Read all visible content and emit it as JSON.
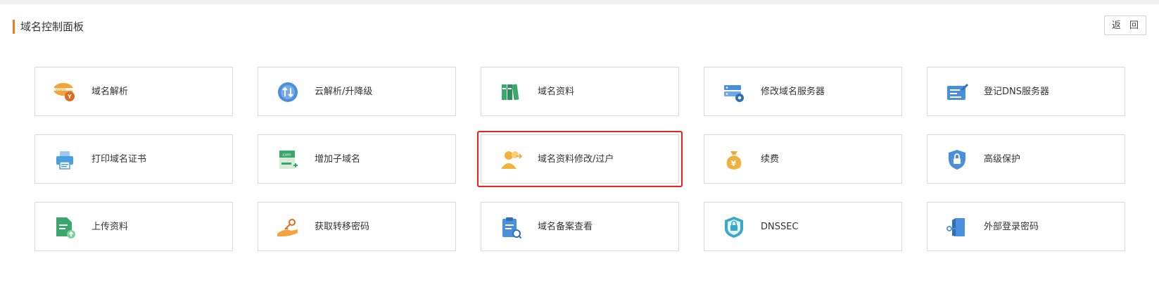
{
  "header": {
    "title": "域名控制面板",
    "back_label": "返 回"
  },
  "colors": {
    "accent": "#f07c22",
    "highlight": "#e8221c"
  },
  "cards": [
    {
      "label": "域名解析",
      "icon": "www-dns-icon"
    },
    {
      "label": "云解析/升降级",
      "icon": "cloud-upgrade-icon"
    },
    {
      "label": "域名资料",
      "icon": "books-icon"
    },
    {
      "label": "修改域名服务器",
      "icon": "server-settings-icon"
    },
    {
      "label": "登记DNS服务器",
      "icon": "register-dns-icon"
    },
    {
      "label": "打印域名证书",
      "icon": "printer-icon"
    },
    {
      "label": "增加子域名",
      "icon": "add-subdomain-icon"
    },
    {
      "label": "域名资料修改/过户",
      "icon": "user-transfer-icon",
      "highlighted": true
    },
    {
      "label": "续费",
      "icon": "money-bag-icon"
    },
    {
      "label": "高级保护",
      "icon": "shield-lock-icon"
    },
    {
      "label": "上传资料",
      "icon": "upload-document-icon"
    },
    {
      "label": "获取转移密码",
      "icon": "hand-key-icon"
    },
    {
      "label": "域名备案查看",
      "icon": "clipboard-search-icon"
    },
    {
      "label": "DNSSEC",
      "icon": "dnssec-badge-icon"
    },
    {
      "label": "外部登录密码",
      "icon": "door-key-icon"
    }
  ]
}
